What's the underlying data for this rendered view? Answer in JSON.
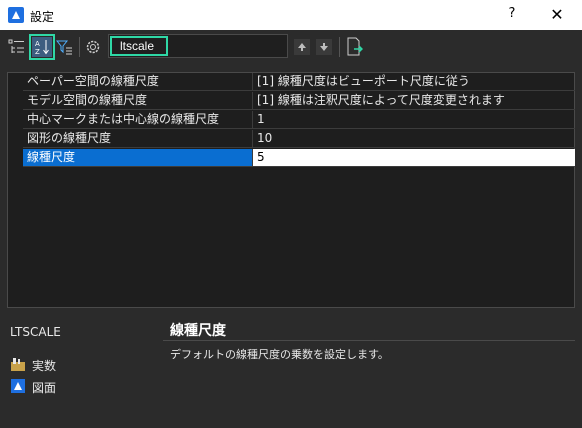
{
  "window": {
    "title": "設定",
    "help_label": "?",
    "close_label": "✕"
  },
  "search": {
    "value": "ltscale"
  },
  "rows": [
    {
      "name": "ペーパー空間の線種尺度",
      "value": "[1] 線種尺度はビューポート尺度に従う"
    },
    {
      "name": "モデル空間の線種尺度",
      "value": "[1] 線種は注釈尺度によって尺度変更されます"
    },
    {
      "name": "中心マークまたは中心線の線種尺度",
      "value": "1"
    },
    {
      "name": "図形の線種尺度",
      "value": "10"
    },
    {
      "name": "線種尺度",
      "value": "5"
    }
  ],
  "details": {
    "command_name": "LTSCALE",
    "title": "線種尺度",
    "description": "デフォルトの線種尺度の乗数を設定します。",
    "type_label": "実数",
    "location_label": "図面"
  },
  "colors": {
    "accent": "#2fd8a6",
    "selection": "#0a6ed1",
    "logo": "#1e6fe0"
  }
}
